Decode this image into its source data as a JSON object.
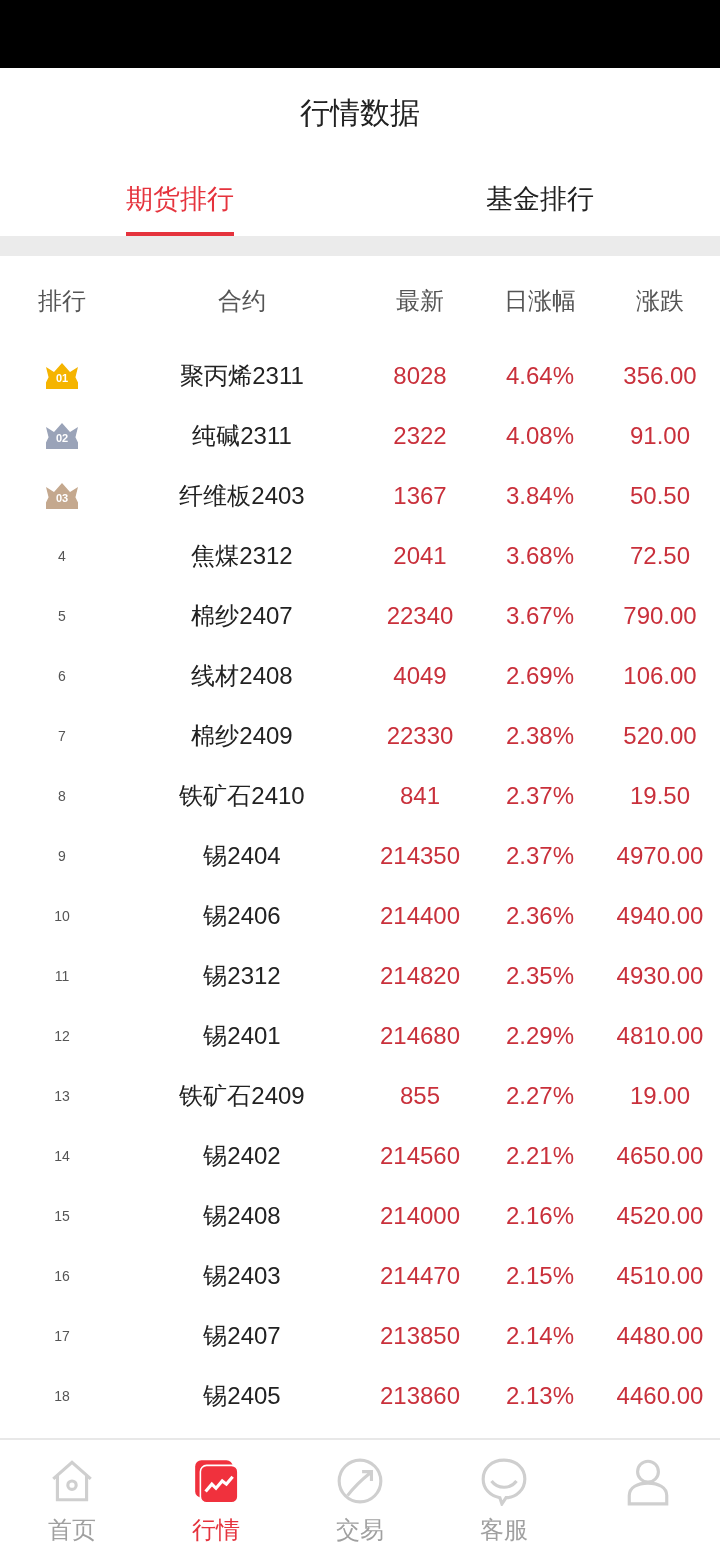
{
  "header": {
    "title": "行情数据"
  },
  "tabs": [
    {
      "label": "期货排行",
      "selected": true
    },
    {
      "label": "基金排行",
      "selected": false
    }
  ],
  "table": {
    "columns": [
      "排行",
      "合约",
      "最新",
      "日涨幅",
      "涨跌"
    ],
    "rows": [
      {
        "rank": "01",
        "color": "#f5b400",
        "name": "聚丙烯2311",
        "latest": "8028",
        "change_pct": "4.64%",
        "change": "356.00"
      },
      {
        "rank": "02",
        "color": "#9aa3b8",
        "name": "纯碱2311",
        "latest": "2322",
        "change_pct": "4.08%",
        "change": "91.00"
      },
      {
        "rank": "03",
        "color": "#c4a88e",
        "name": "纤维板2403",
        "latest": "1367",
        "change_pct": "3.84%",
        "change": "50.50"
      },
      {
        "rank": "4",
        "name": "焦煤2312",
        "latest": "2041",
        "change_pct": "3.68%",
        "change": "72.50"
      },
      {
        "rank": "5",
        "name": "棉纱2407",
        "latest": "22340",
        "change_pct": "3.67%",
        "change": "790.00"
      },
      {
        "rank": "6",
        "name": "线材2408",
        "latest": "4049",
        "change_pct": "2.69%",
        "change": "106.00"
      },
      {
        "rank": "7",
        "name": "棉纱2409",
        "latest": "22330",
        "change_pct": "2.38%",
        "change": "520.00"
      },
      {
        "rank": "8",
        "name": "铁矿石2410",
        "latest": "841",
        "change_pct": "2.37%",
        "change": "19.50"
      },
      {
        "rank": "9",
        "name": "锡2404",
        "latest": "214350",
        "change_pct": "2.37%",
        "change": "4970.00"
      },
      {
        "rank": "10",
        "name": "锡2406",
        "latest": "214400",
        "change_pct": "2.36%",
        "change": "4940.00"
      },
      {
        "rank": "11",
        "name": "锡2312",
        "latest": "214820",
        "change_pct": "2.35%",
        "change": "4930.00"
      },
      {
        "rank": "12",
        "name": "锡2401",
        "latest": "214680",
        "change_pct": "2.29%",
        "change": "4810.00"
      },
      {
        "rank": "13",
        "name": "铁矿石2409",
        "latest": "855",
        "change_pct": "2.27%",
        "change": "19.00"
      },
      {
        "rank": "14",
        "name": "锡2402",
        "latest": "214560",
        "change_pct": "2.21%",
        "change": "4650.00"
      },
      {
        "rank": "15",
        "name": "锡2408",
        "latest": "214000",
        "change_pct": "2.16%",
        "change": "4520.00"
      },
      {
        "rank": "16",
        "name": "锡2403",
        "latest": "214470",
        "change_pct": "2.15%",
        "change": "4510.00"
      },
      {
        "rank": "17",
        "name": "锡2407",
        "latest": "213850",
        "change_pct": "2.14%",
        "change": "4480.00"
      },
      {
        "rank": "18",
        "name": "锡2405",
        "latest": "213860",
        "change_pct": "2.13%",
        "change": "4460.00"
      }
    ]
  },
  "bottom_nav": [
    {
      "label": "首页",
      "selected": false
    },
    {
      "label": "行情",
      "selected": true
    },
    {
      "label": "交易",
      "selected": false
    },
    {
      "label": "客服",
      "selected": false
    },
    {
      "selected": false
    }
  ]
}
